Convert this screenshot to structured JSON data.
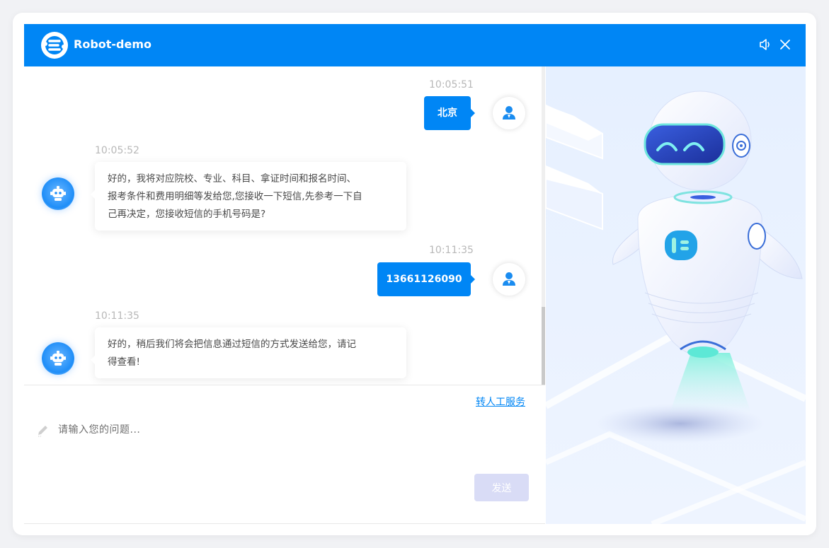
{
  "header": {
    "title": "Robot-demo",
    "logo_icon": "robot-logo-icon",
    "sound_icon": "speaker-icon",
    "close_icon": "close-icon",
    "background_color": "#0086f5"
  },
  "messages": [
    {
      "sender": "user",
      "time": "10:05:51",
      "text": "北京"
    },
    {
      "sender": "bot",
      "time": "10:05:52",
      "lines": [
        "好的，我将对应院校、专业、科目、拿证时间和报名时间、",
        "报考条件和费用明细等发给您,您接收一下短信,先参考一下自",
        "己再决定，您接收短信的手机号码是?"
      ]
    },
    {
      "sender": "user",
      "time": "10:11:35",
      "text": "13661126090"
    },
    {
      "sender": "bot",
      "time": "10:11:35",
      "lines": [
        "好的，稍后我们将会把信息通过短信的方式发送给您，请记",
        "得查看!"
      ]
    }
  ],
  "transfer_link": "转人工服务",
  "input": {
    "placeholder": "请输入您的问题...",
    "value": "",
    "icon": "pencil-icon"
  },
  "send_button": "发送",
  "colors": {
    "accent": "#0086f5",
    "send_disabled": "#d9dcf6",
    "timestamp": "#b8b8b8"
  }
}
